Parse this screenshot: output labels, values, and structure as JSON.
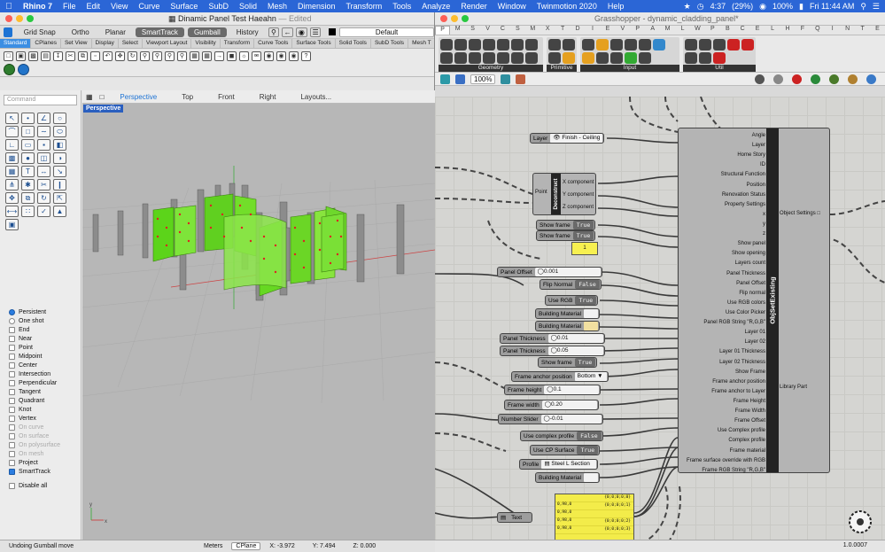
{
  "menubar": {
    "app_name": "Rhino 7",
    "items": [
      "File",
      "Edit",
      "View",
      "Curve",
      "Surface",
      "SubD",
      "Solid",
      "Mesh",
      "Dimension",
      "Transform",
      "Tools",
      "Analyze",
      "Render",
      "Window",
      "Twinmotion 2020",
      "Help"
    ],
    "clock": "4:37",
    "battery_alt": "(29%)",
    "battery": "100%",
    "datetime": "Fri 11:44 AM"
  },
  "rhino": {
    "window_title": "Dinamic Panel Test Haeahn",
    "edited_label": "— Edited",
    "snap_buttons": [
      "Grid Snap",
      "Ortho",
      "Planar",
      "SmartTrack",
      "Gumball",
      "History"
    ],
    "snap_active": [
      "SmartTrack",
      "Gumball"
    ],
    "layer_name": "Default",
    "toolbar_tabs": [
      "Standard",
      "CPlanes",
      "Set View",
      "Display",
      "Select",
      "Viewport Layout",
      "Visibility",
      "Transform",
      "Curve Tools",
      "Surface Tools",
      "Solid Tools",
      "SubD Tools",
      "Mesh T"
    ],
    "active_tab": "Standard",
    "command_placeholder": "Command",
    "viewport_tabs": [
      "Perspective",
      "Top",
      "Front",
      "Right",
      "Layouts..."
    ],
    "active_viewport": "Perspective",
    "viewport_label": "Perspective",
    "osnap": {
      "persistent": "Persistent",
      "one_shot": "One shot",
      "items": [
        {
          "label": "End",
          "checked": false,
          "dim": false
        },
        {
          "label": "Near",
          "checked": false,
          "dim": false
        },
        {
          "label": "Point",
          "checked": false,
          "dim": false
        },
        {
          "label": "Midpoint",
          "checked": false,
          "dim": false
        },
        {
          "label": "Center",
          "checked": false,
          "dim": false
        },
        {
          "label": "Intersection",
          "checked": false,
          "dim": false
        },
        {
          "label": "Perpendicular",
          "checked": false,
          "dim": false
        },
        {
          "label": "Tangent",
          "checked": false,
          "dim": false
        },
        {
          "label": "Quadrant",
          "checked": false,
          "dim": false
        },
        {
          "label": "Knot",
          "checked": false,
          "dim": false
        },
        {
          "label": "Vertex",
          "checked": false,
          "dim": false
        },
        {
          "label": "On curve",
          "checked": false,
          "dim": true
        },
        {
          "label": "On surface",
          "checked": false,
          "dim": true
        },
        {
          "label": "On polysurface",
          "checked": false,
          "dim": true
        },
        {
          "label": "On mesh",
          "checked": false,
          "dim": true
        },
        {
          "label": "Project",
          "checked": false,
          "dim": false
        },
        {
          "label": "SmartTrack",
          "checked": true,
          "dim": false
        }
      ],
      "disable_all": "Disable all"
    },
    "status": {
      "message": "Undoing Gumball move",
      "units": "Meters",
      "cplane": "CPlane",
      "x": "X: -3.972",
      "y": "Y: 7.494",
      "z": "Z: 0.000"
    }
  },
  "grasshopper": {
    "window_title": "Grasshopper - dynamic_cladding_panel*",
    "categories": [
      "P",
      "M",
      "S",
      "V",
      "C",
      "S",
      "M",
      "X",
      "T",
      "D",
      "I",
      "E",
      "V",
      "P",
      "A",
      "M",
      "L",
      "W",
      "P",
      "B",
      "C",
      "E",
      "L",
      "H",
      "F",
      "Q",
      "I",
      "N",
      "T",
      "E"
    ],
    "active_category": "P",
    "ribbon_groups": [
      "Geometry",
      "Primitive",
      "Input",
      "Util"
    ],
    "zoom": "100%",
    "version": "1.0.0007",
    "nodes": {
      "layer_label": "Layer",
      "layer_value": "Finish - Ceiling",
      "point_label": "Point",
      "deconstruct_title": "Deconstruct",
      "deconstruct_outputs": [
        "X component",
        "Y component",
        "Z component"
      ],
      "show_frame_1": {
        "label": "Show frame",
        "value": "True"
      },
      "show_frame_2": {
        "label": "Show frame",
        "value": "True"
      },
      "yellow_value": "1",
      "panel_offset": {
        "label": "Panel Offset",
        "value": "0.001"
      },
      "flip_normal": {
        "label": "Flip Normal",
        "value": "False"
      },
      "use_rgb": {
        "label": "Use RGB",
        "value": "True"
      },
      "building_material_1": "Building Material",
      "building_material_2": "Building Material",
      "panel_thickness_1": {
        "label": "Panel Thickness",
        "value": "0.01"
      },
      "panel_thickness_2": {
        "label": "Panel Thickness",
        "value": "0.05"
      },
      "show_frame_3": {
        "label": "Show frame",
        "value": "True"
      },
      "frame_anchor": {
        "label": "Frame anchor position",
        "value": "Bottom"
      },
      "frame_height": {
        "label": "Frame height",
        "value": "0.1"
      },
      "frame_width": {
        "label": "Frame width",
        "value": "0.20"
      },
      "number_slider": {
        "label": "Number Slider",
        "value": "-0.01"
      },
      "use_complex": {
        "label": "Use complex profile",
        "value": "False"
      },
      "use_cp_surface": {
        "label": "Use CP Surface",
        "value": "True"
      },
      "profile": {
        "label": "Profile",
        "value": "Steel L Section"
      },
      "building_material_3": "Building Material",
      "text_label": "Text"
    },
    "big_component": {
      "title": "ObjSetExisting",
      "inputs": [
        "Angle",
        "Layer",
        "Home Story",
        "ID",
        "Structural Function",
        "Position",
        "Renovation Status",
        "Property Settings",
        "x",
        "y",
        "z",
        "Show panel",
        "Show opening",
        "Layers count",
        "Panel Thickness",
        "Panel Offset",
        "Flip normal",
        "Use RGB colors",
        "Use Color Picker",
        "Panel RGB String \"R,G,B\"",
        "Layer 01",
        "Layer 02",
        "Layer 01 Thickness",
        "Layer 02 Thickness",
        "Show Frame",
        "Frame anchor position",
        "Frame anchor to Layer",
        "Frame Height",
        "Frame Width",
        "Frame Offset",
        "Use Complex profile",
        "Complex profile",
        "Frame material",
        "Frame surface override with RGB",
        "Frame RGB String \"R,G,B\""
      ],
      "outputs": [
        "Object Settings",
        "Library Part"
      ]
    },
    "text_panel_rows": [
      "0,98,0",
      "0,98,0",
      "0,98,0",
      "0,98,0"
    ],
    "text_panel_index": [
      "{0;0;0;0;0}",
      "{0;0;0;0;1}",
      "{0;0;0;0;2}",
      "{0;0;0;0;3}"
    ]
  },
  "colors": {
    "menubar": "#2b66d6",
    "active_tab": "#3b8ee3",
    "panel_green": "#6ee020",
    "node_dark": "#232323",
    "yellow_panel": "#f3ec4a"
  }
}
